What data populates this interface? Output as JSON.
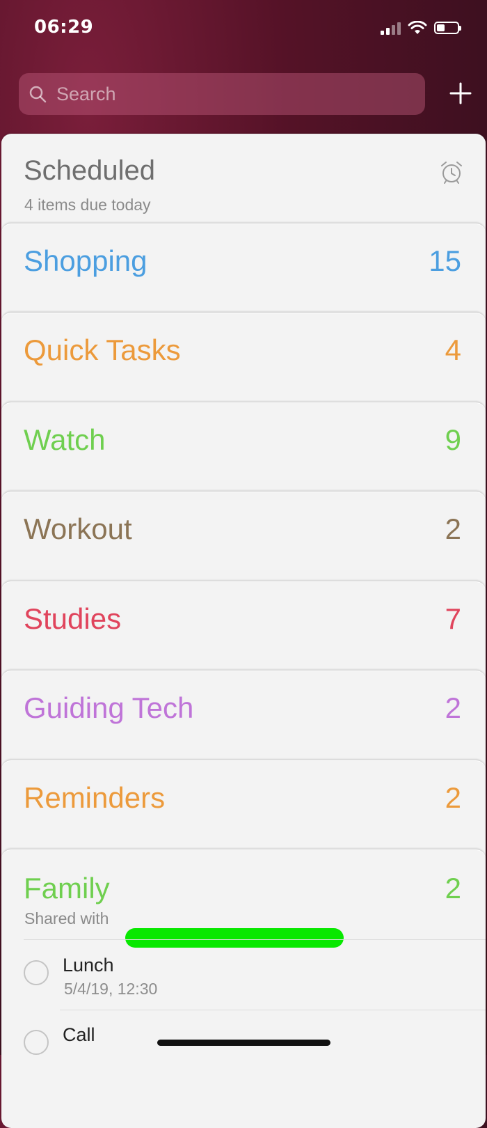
{
  "status_bar": {
    "time": "06:29",
    "battery_level": 0.4
  },
  "search": {
    "placeholder": "Search"
  },
  "scheduled": {
    "title": "Scheduled",
    "subtitle": "4 items due today"
  },
  "lists": [
    {
      "name": "Shopping",
      "count": "15",
      "color": "#4b9ee0"
    },
    {
      "name": "Quick Tasks",
      "count": "4",
      "color": "#ec9a3b"
    },
    {
      "name": "Watch",
      "count": "9",
      "color": "#6fcf4f"
    },
    {
      "name": "Workout",
      "count": "2",
      "color": "#8b7455"
    },
    {
      "name": "Studies",
      "count": "7",
      "color": "#e0445c"
    },
    {
      "name": "Guiding Tech",
      "count": "2",
      "color": "#bf74d8"
    },
    {
      "name": "Reminders",
      "count": "2",
      "color": "#ec9a3b"
    }
  ],
  "family": {
    "name": "Family",
    "count": "2",
    "color": "#6fcf4f",
    "shared_label": "Shared with",
    "items": [
      {
        "title": "Lunch",
        "date": "5/4/19, 12:30"
      },
      {
        "title": "Call",
        "date": ""
      }
    ]
  }
}
